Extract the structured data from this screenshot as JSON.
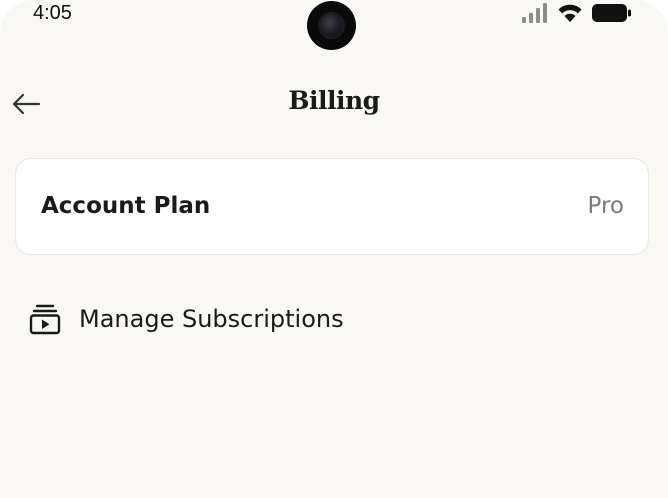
{
  "status_bar": {
    "time": "4:05",
    "icons": [
      "cellular-signal-icon",
      "wifi-icon",
      "battery-icon"
    ]
  },
  "header": {
    "back_icon": "arrow-left-icon",
    "title": "Billing"
  },
  "account_plan": {
    "label": "Account Plan",
    "value": "Pro"
  },
  "manage_subscriptions": {
    "icon": "subscriptions-icon",
    "label": "Manage Subscriptions"
  },
  "colors": {
    "background": "#f9f8f4",
    "card": "#ffffff",
    "text_primary": "#1a1a1a",
    "text_secondary": "#7d7b76"
  }
}
